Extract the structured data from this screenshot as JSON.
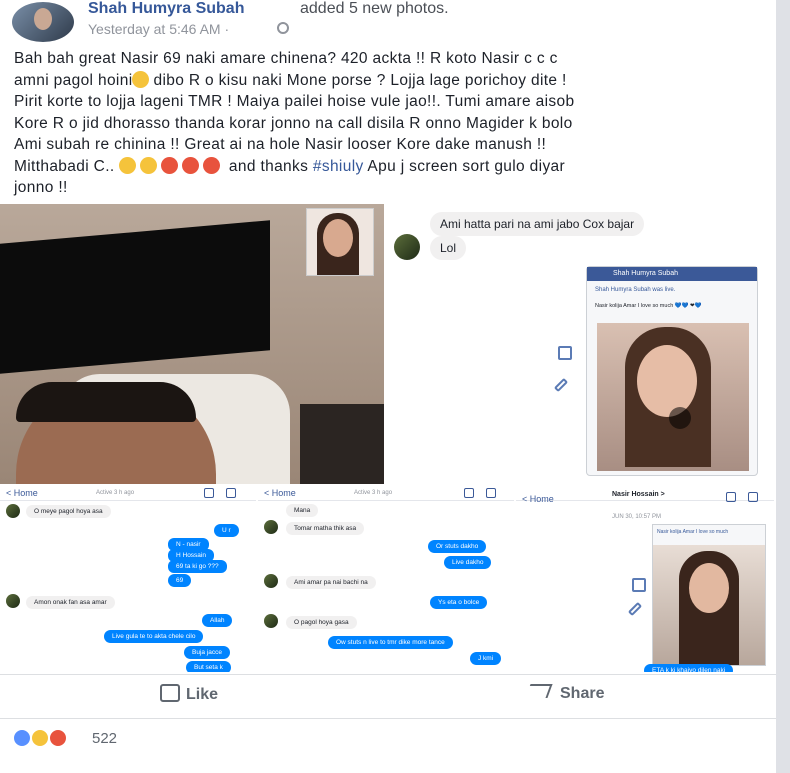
{
  "post": {
    "author": "Shah Humyra Subah",
    "action": "added 5 new photos.",
    "timestamp": "Yesterday at 5:46 AM ·",
    "text_line1": "Bah bah great Nasir 69 naki amare chinena? 420 ackta !! R koto Nasir c c c",
    "text_line2a": "amni pagol hoini",
    "text_line2b": "dibo R o kisu naki Mone porse ? Lojja lage porichoy dite !",
    "text_line3": "Pirit korte to lojja lageni TMR ! Maiya pailei hoise vule jao!!. Tumi amare aisob",
    "text_line4": "Kore R o jid dhorasso thanda korar jonno na call disila R onno Magider k bolo",
    "text_line5": "Ami subah re chinina !! Great ai na hole Nasir looser Kore dake manush !!",
    "text_line6a": "Mitthabadi C..",
    "text_line6b": "and thanks",
    "hashtag": "#shiuly",
    "text_line6c": "Apu j screen sort gulo diyar",
    "text_line7": "jonno !!"
  },
  "photo2": {
    "msg1": "Ami hatta pari na ami jabo Cox bajar",
    "msg2": "Lol",
    "phone_bar": "Shah Humyra Subah",
    "phone_post_author": "Shah Humyra Subah was live.",
    "phone_post_text": "Nasir kolija Amar I love so much 💙💙 ❤💙"
  },
  "photo3": {
    "back": "< Home",
    "active": "Active 3 h ago",
    "in1": "O meye pagol hoya asa",
    "out1": "U r",
    "out2": "N - nasir",
    "out3": "H Hossain",
    "out4": "69 ta ki go ???",
    "out5": "69",
    "in2": "Amon onak fan asa amar",
    "out6": "Allah",
    "out7": "Live gula te to akta chele cilo",
    "out8": "Buja jacce",
    "out9": "But seta k"
  },
  "photo4": {
    "back": "< Home",
    "active": "Active 3 h ago",
    "in1": "Mana",
    "in2": "Tomar matha thik asa",
    "out1": "Or stuts dakho",
    "out2": "Live dakho",
    "in3": "Ami amar pa nai bachi na",
    "out3": "Ys eta o bolce",
    "in4": "O pagol hoya gasa",
    "out4": "Ow stuts n live to tmr dike more tance",
    "out5": "J kmi"
  },
  "photo5": {
    "back": "< Home",
    "contact": "Nasir Hossain >",
    "date": "JUN 30, 10:57 PM",
    "inner": "Nasir kolija Amar I love so much",
    "out1": "ETA k ki khaiyo dilen naki"
  },
  "actions": {
    "like": "Like",
    "share": "Share"
  },
  "reactions": {
    "count": "522",
    "colors": {
      "like": "#5890ff",
      "haha": "#f5c33b",
      "angry": "#e8533d"
    }
  }
}
